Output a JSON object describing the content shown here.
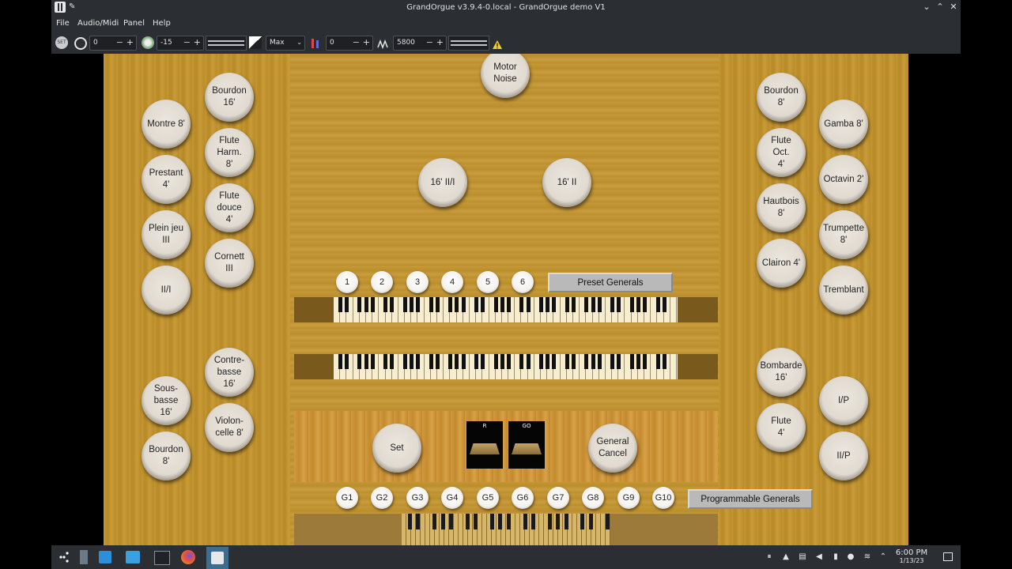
{
  "window": {
    "title": "GrandOrgue v3.9.4-0.local - GrandOrgue demo V1"
  },
  "menu": {
    "file": "File",
    "audio": "Audio/Midi",
    "panel": "Panel",
    "help": "Help"
  },
  "toolbar": {
    "set_label": "SET",
    "transpose": "0",
    "volume": "-15",
    "polyphony_mode": "Max",
    "tuning": "0",
    "pitch": "5800",
    "warning_icon": "warning-icon"
  },
  "stops_left_outer": [
    "Montre 8'",
    "Prestant\n4'",
    "Plein jeu\nIII",
    "II/I",
    "Sous-\nbasse\n16'",
    "Bourdon\n8'"
  ],
  "stops_left_inner": [
    "Bourdon\n16'",
    "Flute\nHarm.\n8'",
    "Flute\ndouce\n4'",
    "Cornett\nIII",
    "Contre-\nbasse\n16'",
    "Violon-\ncelle 8'"
  ],
  "stops_right_inner": [
    "Bourdon\n8'",
    "Flute\nOct.\n4'",
    "Hautbois\n8'",
    "Clairon 4'",
    "Bombarde\n16'",
    "Flute\n4'"
  ],
  "stops_right_outer": [
    "Gamba 8'",
    "Octavin 2'",
    "Trumpette\n8'",
    "Tremblant",
    "I/P",
    "II/P"
  ],
  "center": {
    "motor_noise": "Motor\nNoise",
    "coupler_a": "16' II/I",
    "coupler_b": "16' II",
    "set": "Set",
    "general_cancel": "General\nCancel",
    "preset_generals": "Preset Generals",
    "programmable_generals": "Programmable Generals",
    "swell_r": "R",
    "swell_go": "GO"
  },
  "presets": [
    "1",
    "2",
    "3",
    "4",
    "5",
    "6"
  ],
  "generals": [
    "G1",
    "G2",
    "G3",
    "G4",
    "G5",
    "G6",
    "G7",
    "G8",
    "G9",
    "G10"
  ],
  "taskbar": {
    "time": "6:00 PM",
    "date": "1/13/23"
  },
  "colors": {
    "wood": "#c29531",
    "chrome": "#2b2e32",
    "stop_face": "#e6e0d6"
  }
}
